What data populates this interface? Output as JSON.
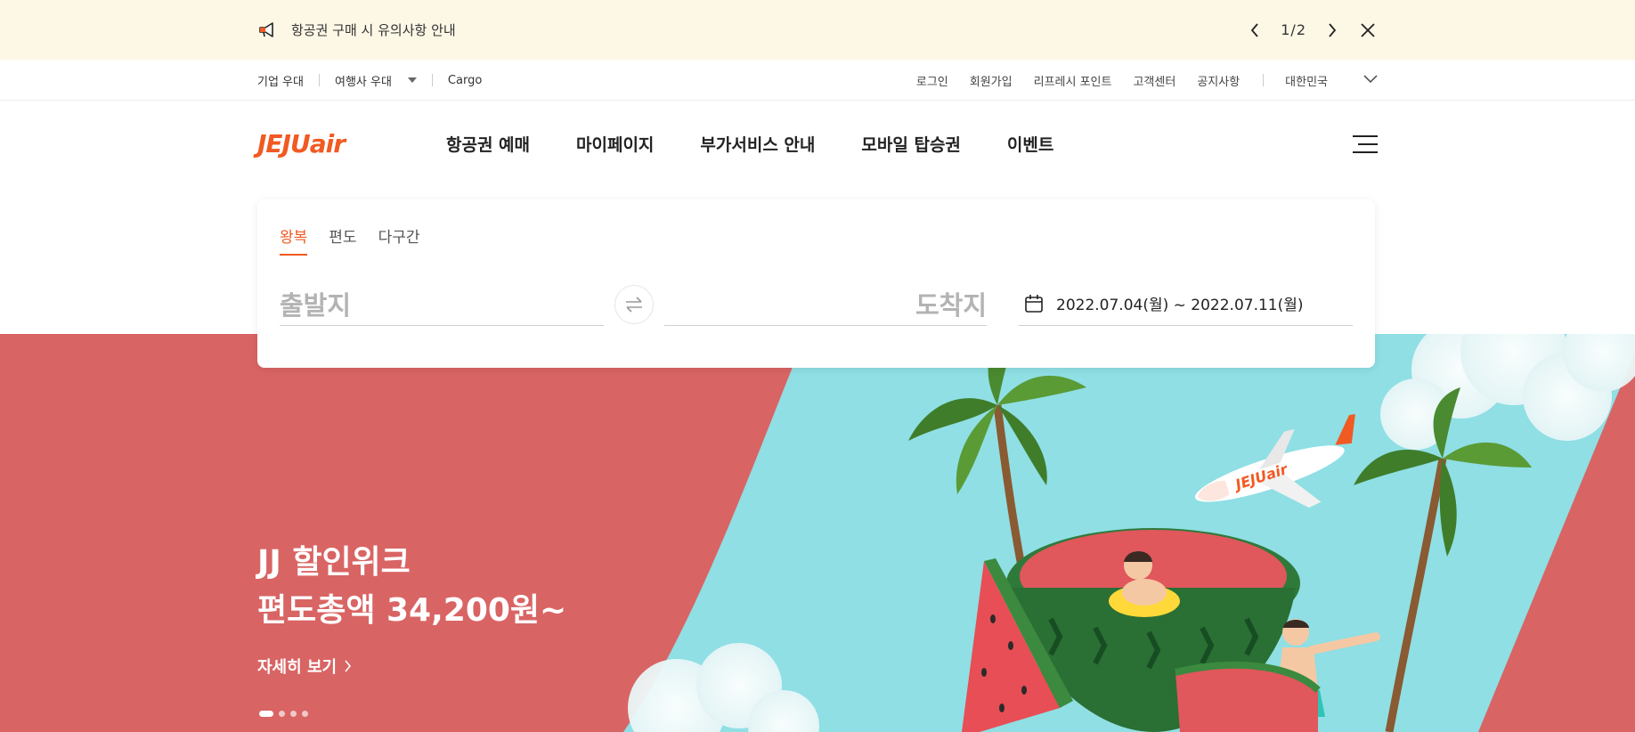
{
  "notice": {
    "text": "항공권 구매 시 유의사항 안내",
    "pager": "1/2",
    "icons": [
      "megaphone-icon",
      "chevron-left-icon",
      "chevron-right-icon",
      "close-icon"
    ]
  },
  "util": {
    "corporate": "기업 우대",
    "agency": "여행사 우대",
    "cargo": "Cargo",
    "links": [
      "로그인",
      "회원가입",
      "리프레시 포인트",
      "고객센터",
      "공지사항"
    ],
    "country": "대한민국"
  },
  "header": {
    "logo": "JEJUair",
    "nav": [
      "항공권 예매",
      "마이페이지",
      "부가서비스 안내",
      "모바일 탑승권",
      "이벤트"
    ]
  },
  "booking": {
    "tabs": [
      "왕복",
      "편도",
      "다구간"
    ],
    "active_tab": "왕복",
    "departure_placeholder": "출발지",
    "arrival_placeholder": "도착지",
    "dates": "2022.07.04(월) ~ 2022.07.11(월)"
  },
  "hero": {
    "line1": "JJ 할인위크",
    "line2": "편도총액 34,200원~",
    "more": "자세히 보기",
    "slide_count": 4,
    "active_slide": 1,
    "plane_text": "JEJUair",
    "colors": {
      "bg": "#d96464",
      "sea": "#8fdfe4",
      "accent": "#f15a22"
    }
  }
}
